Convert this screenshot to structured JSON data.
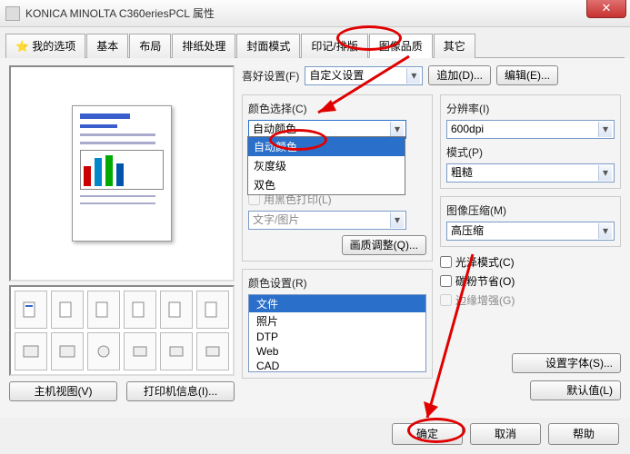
{
  "window": {
    "title": "KONICA MINOLTA C360eriesPCL 属性"
  },
  "tabs": {
    "t0": "我的选项",
    "t1": "基本",
    "t2": "布局",
    "t3": "排纸处理",
    "t4": "封面模式",
    "t5": "印记/排版",
    "t6": "图像品质",
    "t7": "其它"
  },
  "fav": {
    "label": "喜好设置(F)",
    "value": "自定义设置",
    "add": "追加(D)...",
    "edit": "编辑(E)..."
  },
  "color": {
    "select_label": "颜色选择(C)",
    "value": "自动颜色",
    "opt_auto": "自动颜色",
    "opt_gray": "灰度级",
    "opt_two": "双色",
    "black_chk": "用黑色打印(L)",
    "pattern": "文字/图片",
    "quality_btn": "画质调整(Q)...",
    "setting_label": "颜色设置(R)",
    "list_file": "文件",
    "list_photo": "照片",
    "list_dtp": "DTP",
    "list_web": "Web",
    "list_cad": "CAD"
  },
  "res": {
    "label": "分辨率(I)",
    "value": "600dpi"
  },
  "mode": {
    "label": "模式(P)",
    "value": "粗糙"
  },
  "comp": {
    "label": "图像压缩(M)",
    "value": "高压缩"
  },
  "gloss": "光泽模式(C)",
  "toner": "碳粉节省(O)",
  "edge": "边缘增强(G)",
  "fontbtn": "设置字体(S)...",
  "left": {
    "host_view": "主机视图(V)",
    "printer_info": "打印机信息(I)..."
  },
  "footer": {
    "default": "默认值(L)",
    "ok": "确定",
    "cancel": "取消",
    "help": "帮助"
  }
}
